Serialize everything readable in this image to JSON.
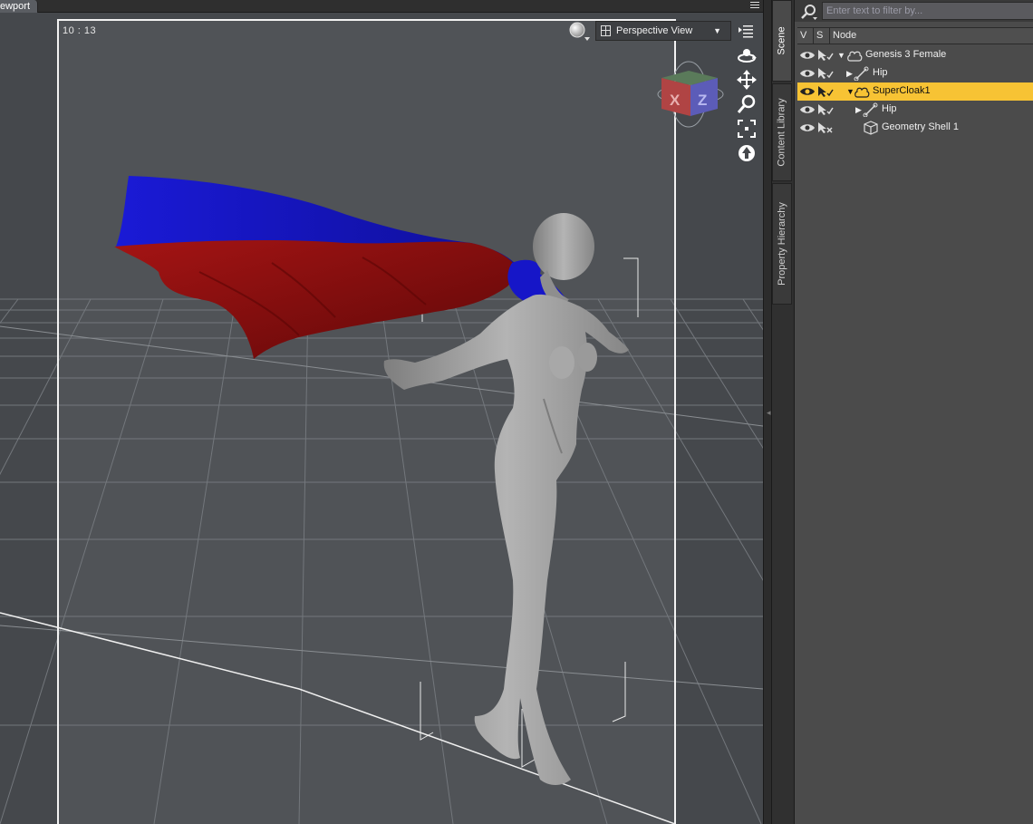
{
  "viewport": {
    "tab_label": "ewport",
    "time_readout": "10 : 13",
    "view_mode": "Perspective View",
    "cube_labels": {
      "x": "X",
      "z": "Z"
    }
  },
  "side_tabs": [
    {
      "label": "Scene",
      "active": true
    },
    {
      "label": "Content Library",
      "active": false
    },
    {
      "label": "Property Hierarchy",
      "active": false
    }
  ],
  "scene": {
    "filter_placeholder": "Enter text to filter by...",
    "columns": {
      "v": "V",
      "s": "S",
      "node": "Node"
    },
    "nodes": [
      {
        "label": "Genesis 3 Female",
        "type": "figure",
        "expanded": true,
        "selected": false,
        "selectable": true
      },
      {
        "label": "Hip",
        "type": "bone",
        "expanded": false,
        "selected": false,
        "selectable": true
      },
      {
        "label": "SuperCloak1",
        "type": "figure",
        "expanded": true,
        "selected": true,
        "selectable": true
      },
      {
        "label": "Hip",
        "type": "bone",
        "expanded": false,
        "selected": false,
        "selectable": true
      },
      {
        "label": "Geometry Shell 1",
        "type": "geometry-shell",
        "expanded": null,
        "selected": false,
        "selectable": false
      }
    ]
  },
  "colors": {
    "selection": "#f7c334",
    "cloak_outer": "#1616c8",
    "cloak_inner": "#8c0c0c",
    "figure": "#9a9a9a",
    "viewport_bg": "#45484c"
  }
}
